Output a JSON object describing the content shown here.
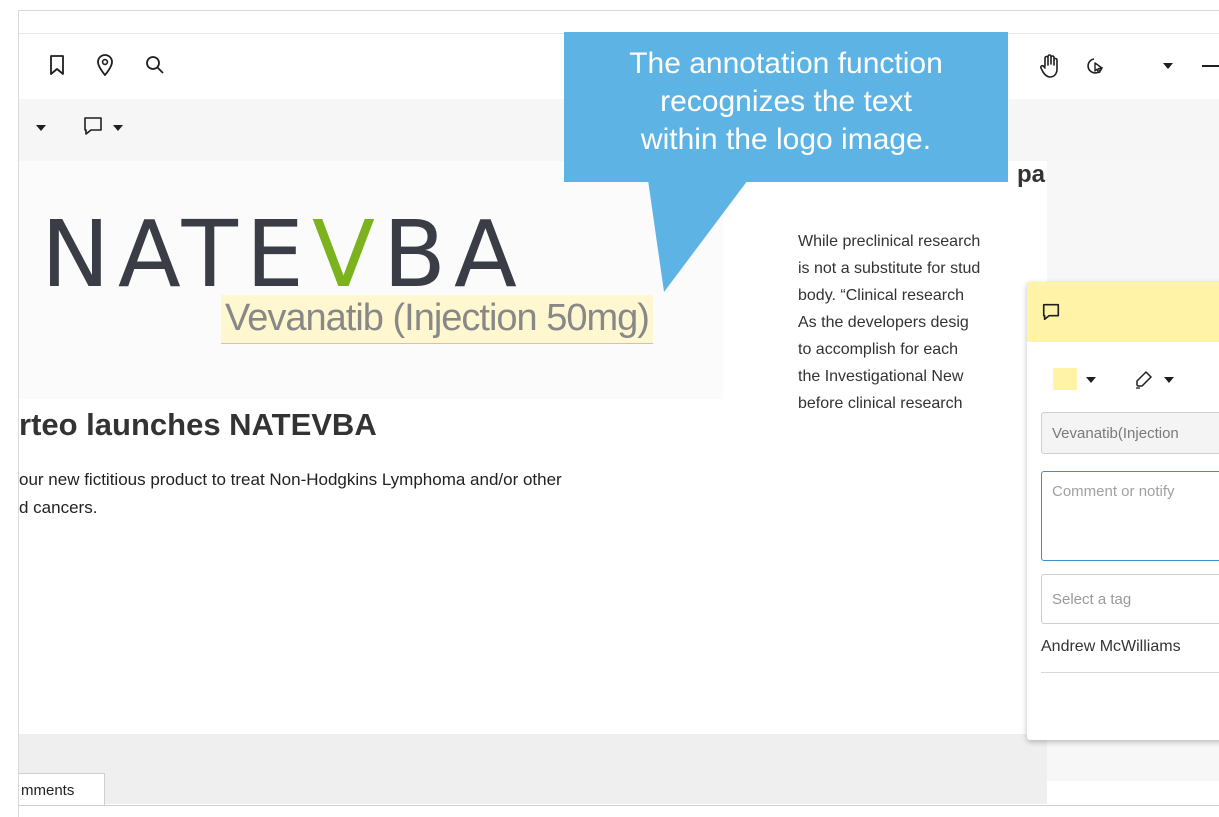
{
  "toolbar": {
    "bookmark_icon": "bookmark-icon",
    "location_icon": "map-pin-icon",
    "search_icon": "search-icon",
    "pan_icon": "hand-icon",
    "select_icon": "pointer-icon",
    "comment_icon": "comment-icon"
  },
  "document": {
    "logo_text": "NATEVBA",
    "logo_subtext": "Vevanatib (Injection 50mg)",
    "headline": "rteo launches NATEVBA",
    "paragraph_line1": "our new fictitious product to treat Non-Hodgkins Lymphoma and/or other",
    "paragraph_line2": "d cancers.",
    "right_heading_fragment": "pa",
    "right_col_lines": [
      "While preclinical research",
      "is not a substitute for stud",
      "body. “Clinical research",
      "As the developers desig",
      "to accomplish for each",
      "the Investigational New",
      "before clinical research"
    ]
  },
  "annotation_popup": {
    "color": "#fef3a6",
    "selected_text": "Vevanatib(Injection",
    "comment_placeholder": "Comment or notify",
    "tag_placeholder": "Select a tag",
    "author": "Andrew McWilliams"
  },
  "bottom": {
    "comments_tab_label": "mments"
  },
  "callout": {
    "line1": "The annotation function",
    "line2": "recognizes the text",
    "line3": "within the logo image.",
    "color": "#5db4e4"
  }
}
